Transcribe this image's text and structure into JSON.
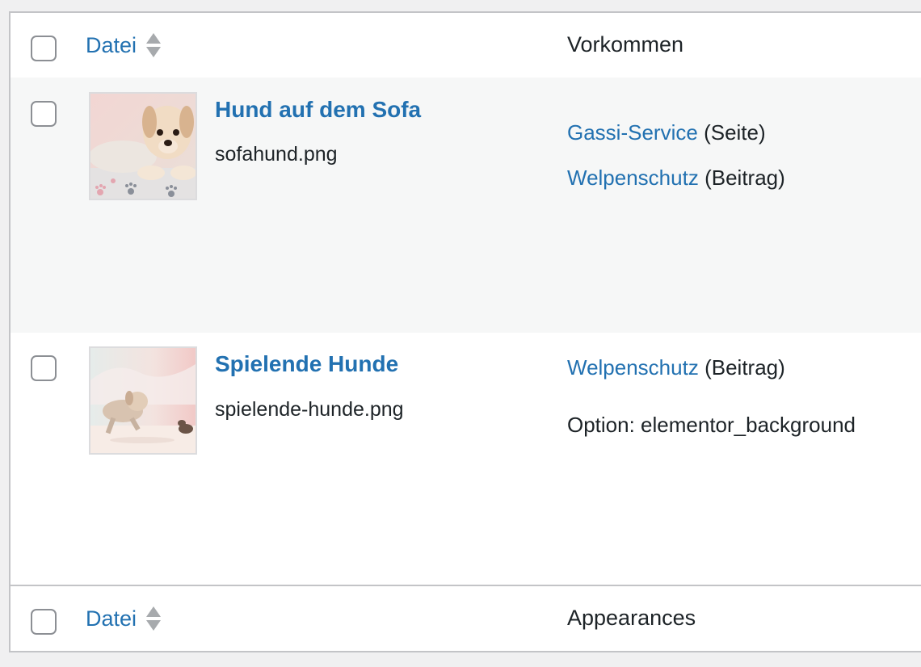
{
  "header": {
    "file_col_label": "Datei",
    "usage_col_label": "Vorkommen"
  },
  "rows": [
    {
      "title": "Hund auf dem Sofa",
      "filename": "sofahund.png",
      "thumbnail_icon": "puppy-on-sofa-image",
      "usages": [
        {
          "link": "Gassi-Service",
          "type": "(Seite)"
        },
        {
          "link": "Welpenschutz",
          "type": "(Beitrag)"
        }
      ]
    },
    {
      "title": "Spielende Hunde",
      "filename": "spielende-hunde.png",
      "thumbnail_icon": "playing-dogs-image",
      "usages": [
        {
          "link": "Welpenschutz",
          "type": "(Beitrag)"
        },
        {
          "text": "Option: elementor_background"
        }
      ]
    }
  ],
  "footer": {
    "file_col_label": "Datei",
    "usage_col_label": "Appearances"
  },
  "colors": {
    "link": "#2271b1",
    "text": "#1d2327",
    "alt_row": "#f6f7f7",
    "border": "#c3c4c7"
  }
}
